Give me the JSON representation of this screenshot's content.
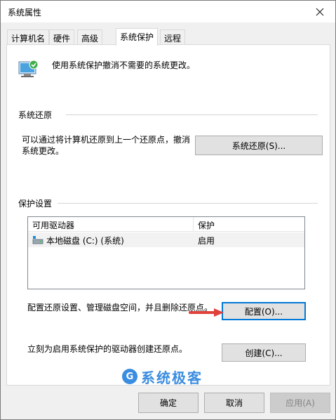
{
  "window": {
    "title": "系统属性",
    "close_icon": "close-icon"
  },
  "tabs": [
    {
      "label": "计算机名",
      "active": false
    },
    {
      "label": "硬件",
      "active": false
    },
    {
      "label": "高级",
      "active": false
    },
    {
      "label": "系统保护",
      "active": true
    },
    {
      "label": "远程",
      "active": false
    }
  ],
  "intro": {
    "text": "使用系统保护撤消不需要的系统更改。",
    "icon": "system-protection-icon"
  },
  "restore": {
    "title": "系统还原",
    "description_line1": "可以通过将计算机还原到上一个还原点，撤消",
    "description_line2": "系统更改。",
    "button": "系统还原(S)..."
  },
  "protection": {
    "title": "保护设置",
    "columns": [
      "可用驱动器",
      "保护"
    ],
    "rows": [
      {
        "drive": "本地磁盘 (C:) (系统)",
        "status": "启用"
      }
    ],
    "configure_text": "配置还原设置、管理磁盘空间，并且删除还原点。",
    "configure_button": "配置(O)...",
    "create_text": "立刻为启用系统保护的驱动器创建还原点。",
    "create_button": "创建(C)..."
  },
  "footer": {
    "ok": "确定",
    "cancel": "取消",
    "apply": "应用(A)"
  },
  "watermark": {
    "text": "系统极客",
    "logo": "G"
  },
  "colors": {
    "accent": "#0078d7",
    "arrow": "#e0413a",
    "watermark": "#3b8de0"
  }
}
